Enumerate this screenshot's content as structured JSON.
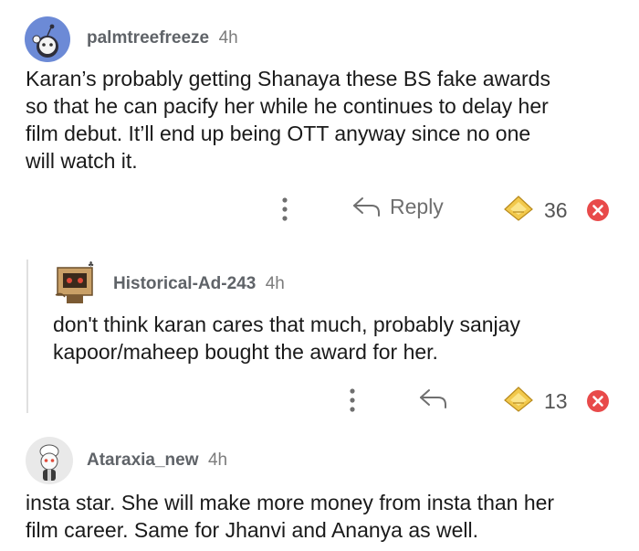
{
  "comments": [
    {
      "username": "palmtreefreeze",
      "time": "4h",
      "text_lines": [
        "Karan’s probably getting Shanaya these BS fake awards",
        "so that he can pacify her while he continues to delay her",
        "film debut. It’ll end up being OTT anyway since no one",
        "will watch it."
      ],
      "reply_label": "Reply",
      "votes": "36",
      "avatar_color": "#6c8ad6"
    },
    {
      "username": "Historical-Ad-243",
      "time": "4h",
      "text_lines": [
        "don't think karan cares that much, probably sanjay",
        "kapoor/maheep bought the award for her."
      ],
      "votes": "13"
    },
    {
      "username": "Ataraxia_new",
      "time": "4h",
      "text_lines": [
        "insta star. She will make more money from insta than her",
        "film career. Same for Jhanvi and Ananya as well."
      ]
    }
  ],
  "icons": {
    "more": "more-options-icon",
    "reply": "reply-arrow-icon",
    "award": "gold-award-icon",
    "remove": "remove-x-icon"
  },
  "colors": {
    "award_gold": "#f2c94c",
    "remove_red": "#e84a4a"
  }
}
